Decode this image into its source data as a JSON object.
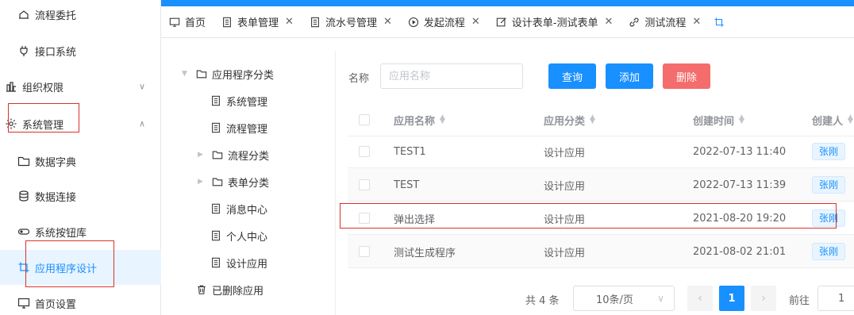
{
  "sidebar": {
    "items": [
      {
        "label": "流程委托",
        "icon": "home-cloud-icon"
      },
      {
        "label": "接口系统",
        "icon": "plug-icon"
      },
      {
        "label": "组织权限",
        "icon": "org-chart-icon"
      },
      {
        "label": "系统管理",
        "icon": "gear-icon"
      },
      {
        "label": "数据字典",
        "icon": "folder-icon"
      },
      {
        "label": "数据连接",
        "icon": "database-icon"
      },
      {
        "label": "系统按钮库",
        "icon": "toggle-icon"
      },
      {
        "label": "应用程序设计",
        "icon": "crop-icon"
      },
      {
        "label": "首页设置",
        "icon": "monitor-icon"
      }
    ]
  },
  "tabs": [
    {
      "label": "首页",
      "icon": "monitor-icon"
    },
    {
      "label": "表单管理",
      "icon": "document-icon"
    },
    {
      "label": "流水号管理",
      "icon": "document-icon"
    },
    {
      "label": "发起流程",
      "icon": "play-circle-icon"
    },
    {
      "label": "设计表单-测试表单",
      "icon": "edit-icon"
    },
    {
      "label": "测试流程",
      "icon": "link-icon"
    }
  ],
  "tree": [
    {
      "label": "应用程序分类",
      "type": "folder",
      "expanded": true
    },
    {
      "label": "系统管理",
      "type": "doc"
    },
    {
      "label": "流程管理",
      "type": "doc"
    },
    {
      "label": "流程分类",
      "type": "folder",
      "expanded": false
    },
    {
      "label": "表单分类",
      "type": "folder",
      "expanded": false
    },
    {
      "label": "消息中心",
      "type": "doc"
    },
    {
      "label": "个人中心",
      "type": "doc"
    },
    {
      "label": "设计应用",
      "type": "doc"
    },
    {
      "label": "已删除应用",
      "type": "trash"
    }
  ],
  "search": {
    "label": "名称",
    "placeholder": "应用名称",
    "query_label": "查询",
    "add_label": "添加",
    "delete_label": "删除"
  },
  "table": {
    "columns": [
      "应用名称",
      "应用分类",
      "创建时间",
      "创建人"
    ],
    "rows": [
      {
        "name": "TEST1",
        "category": "设计应用",
        "created": "2022-07-13 11:40",
        "creator": "张刚"
      },
      {
        "name": "TEST",
        "category": "设计应用",
        "created": "2022-07-13 11:39",
        "creator": "张刚"
      },
      {
        "name": "弹出选择",
        "category": "设计应用",
        "created": "2021-08-20 19:20",
        "creator": "张刚"
      },
      {
        "name": "测试生成程序",
        "category": "设计应用",
        "created": "2021-08-02 21:01",
        "creator": "张刚"
      }
    ]
  },
  "pager": {
    "total": "共 4 条",
    "page_size": "10条/页",
    "current": "1",
    "goto_label": "前往",
    "goto_value": "1"
  },
  "colors": {
    "primary": "#1890ff",
    "danger": "#f56c6c",
    "annotation": "#d9322c"
  }
}
